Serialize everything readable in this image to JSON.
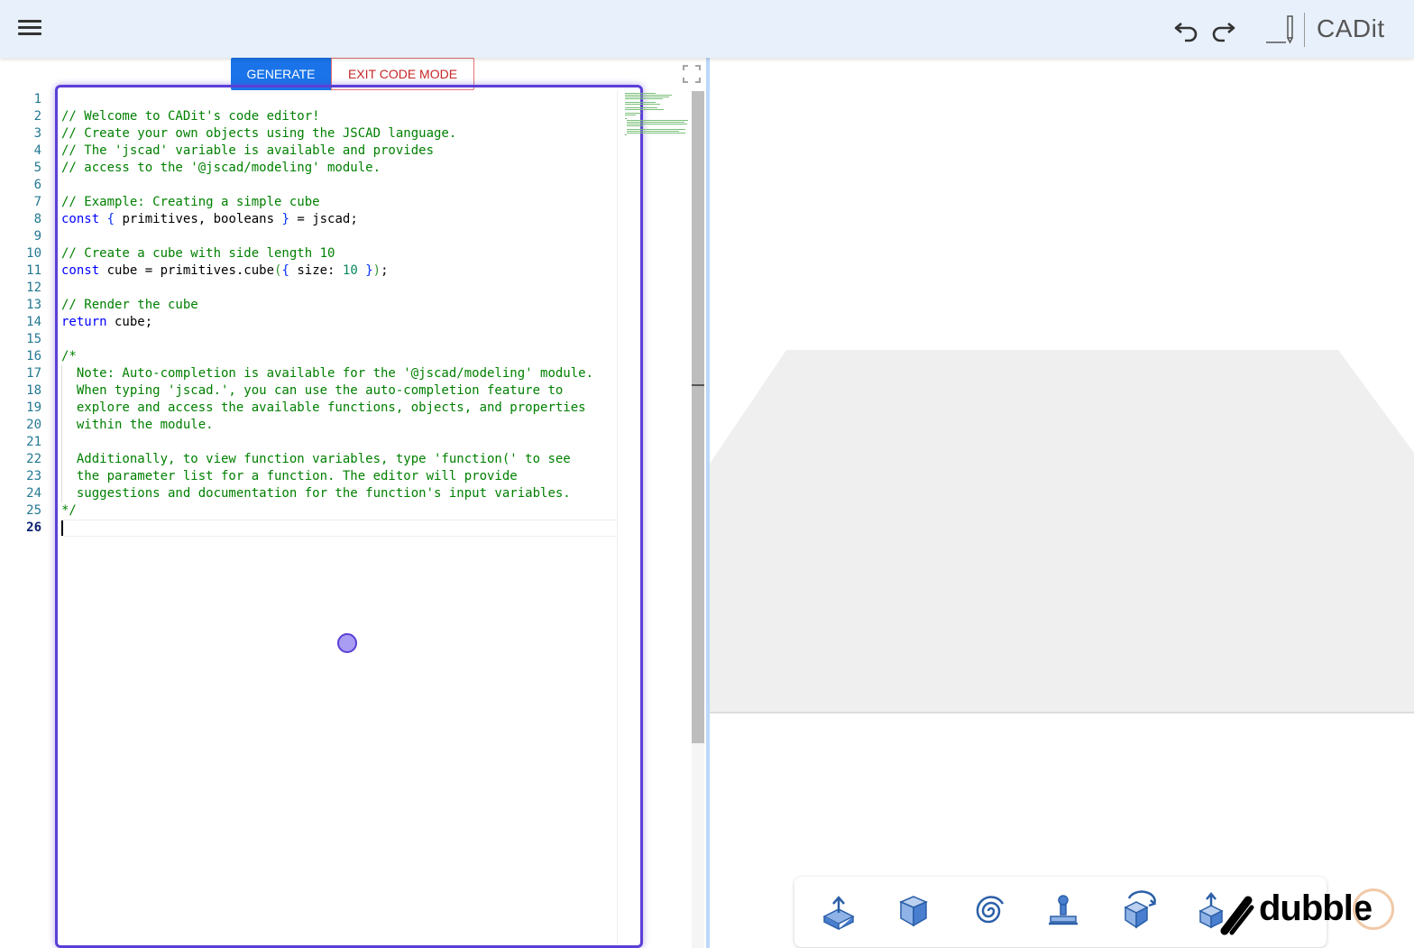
{
  "app": {
    "brand": "CADit"
  },
  "toolbar": {
    "generate_label": "GENERATE",
    "exit_code_mode_label": "EXIT CODE MODE"
  },
  "editor": {
    "line_numbers": [
      "1",
      "2",
      "3",
      "4",
      "5",
      "6",
      "7",
      "8",
      "9",
      "10",
      "11",
      "12",
      "13",
      "14",
      "15",
      "16",
      "17",
      "18",
      "19",
      "20",
      "21",
      "22",
      "23",
      "24",
      "25",
      "26"
    ],
    "active_line": "26",
    "lines": [
      "",
      "// Welcome to CADit's code editor!",
      "// Create your own objects using the JSCAD language.",
      "// The 'jscad' variable is available and provides",
      "// access to the '@jscad/modeling' module.",
      "",
      "// Example: Creating a simple cube",
      "const { primitives, booleans } = jscad;",
      "",
      "// Create a cube with side length 10",
      "const cube = primitives.cube({ size: 10 });",
      "",
      "// Render the cube",
      "return cube;",
      "",
      "/*",
      "  Note: Auto-completion is available for the '@jscad/modeling' module.",
      "  When typing 'jscad.', you can use the auto-completion feature to",
      "  explore and access the available functions, objects, and properties",
      "  within the module.",
      "",
      "  Additionally, to view function variables, type 'function(' to see",
      "  the parameter list for a function. The editor will provide",
      "  suggestions and documentation for the function's input variables.",
      "*/",
      ""
    ]
  },
  "bottom_tools": [
    "extrude-icon",
    "box-icon",
    "spiral-icon",
    "stamp-icon",
    "rotate-icon",
    "move-icon"
  ],
  "watermark": "dubble",
  "colors": {
    "accent": "#1a73e8",
    "selection": "#5b3fd6",
    "topbar": "#e8f0fb",
    "viewer_surface": "#efefef"
  }
}
